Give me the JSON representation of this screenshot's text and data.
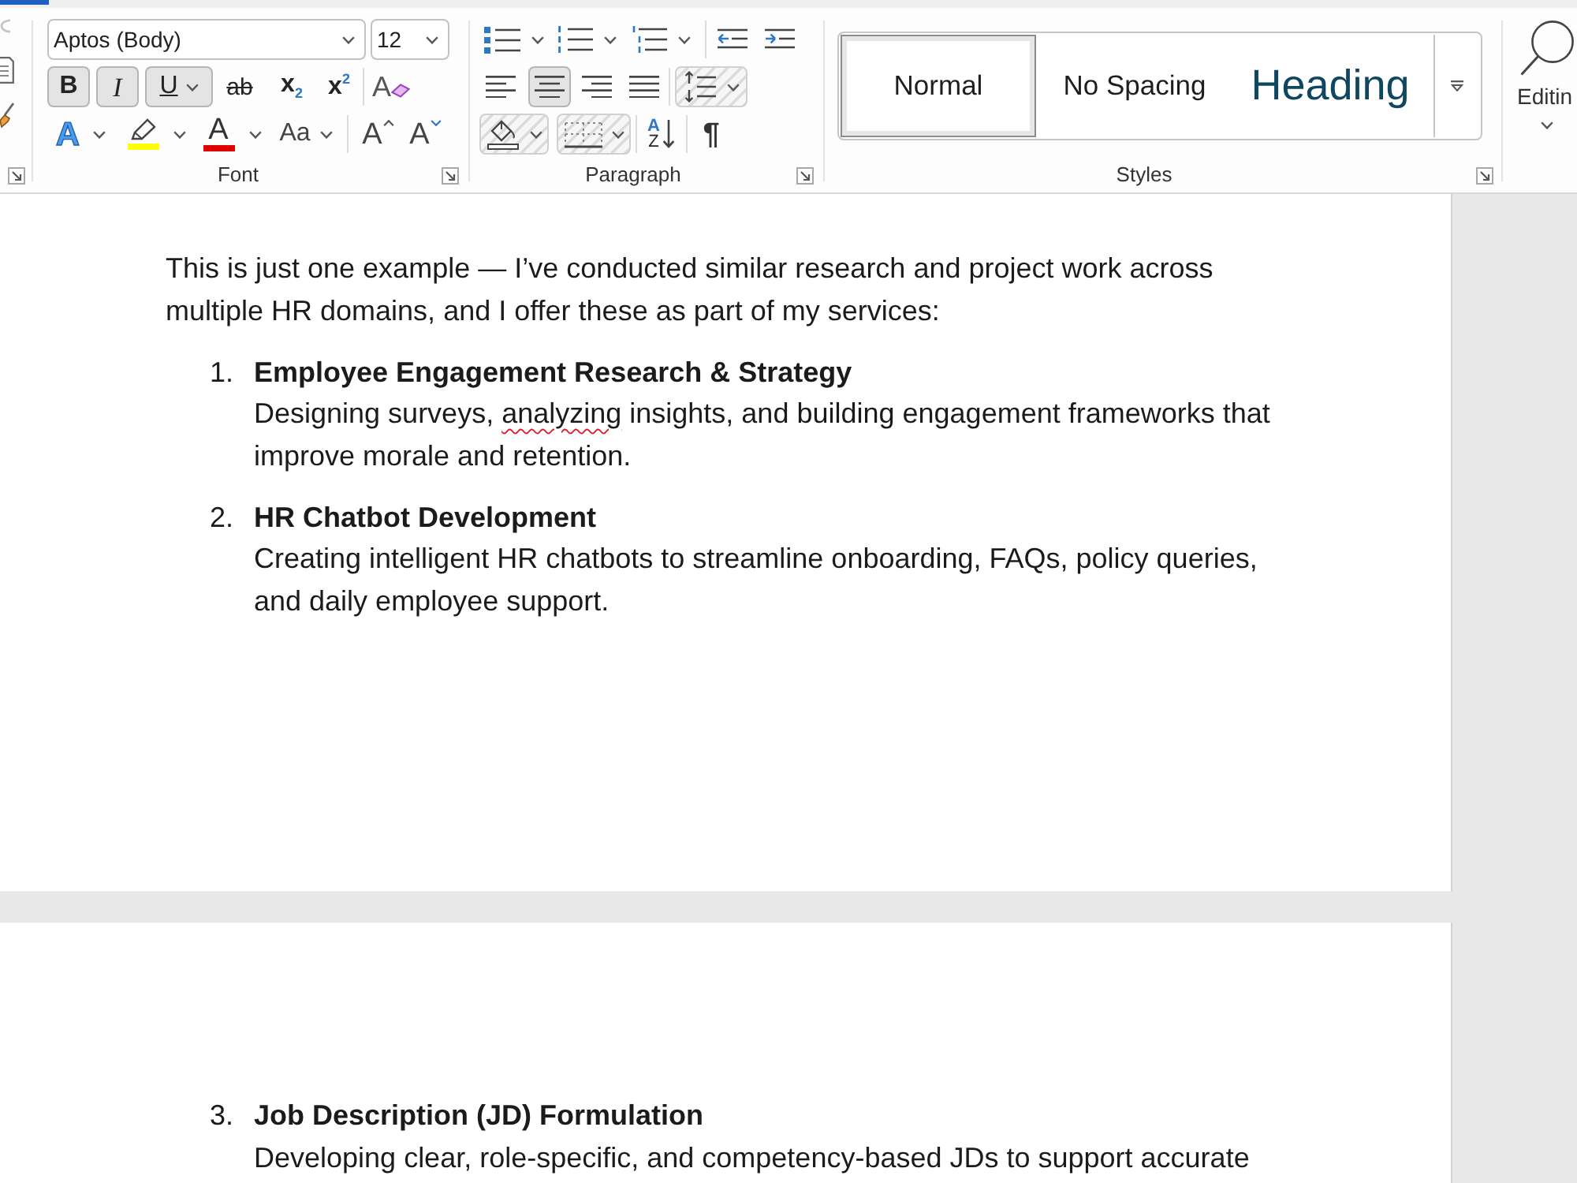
{
  "ribbon": {
    "font_group": {
      "label": "Font",
      "font_name": "Aptos (Body)",
      "font_size": "12",
      "style_buttons": [
        {
          "kind": "bold",
          "text": "B",
          "selected": true
        },
        {
          "kind": "italic",
          "text": "I",
          "selected": true
        },
        {
          "kind": "underline",
          "text": "U",
          "selected": true
        },
        {
          "kind": "strikethrough",
          "text": "ab",
          "selected": false
        },
        {
          "kind": "subscript",
          "text": "x$_{2}$",
          "selected": false
        },
        {
          "kind": "superscript",
          "text": "x$^{2}$",
          "selected": false
        },
        {
          "kind": "clear_formatting",
          "text": "A",
          "selected": false
        }
      ],
      "color_buttons": [
        {
          "kind": "text_effects",
          "text": "A"
        },
        {
          "kind": "highlight",
          "color": "#ffff00"
        },
        {
          "kind": "font_color",
          "text": "A",
          "color": "#e00000"
        },
        {
          "kind": "change_case",
          "text": "Aa"
        },
        {
          "kind": "grow_font",
          "text": "A"
        },
        {
          "kind": "shrink_font",
          "text": "A"
        }
      ]
    },
    "paragraph_group": {
      "label": "Paragraph",
      "list_buttons": [
        {
          "kind": "bullets"
        },
        {
          "kind": "numbering"
        },
        {
          "kind": "multilevel"
        },
        {
          "kind": "decrease_indent"
        },
        {
          "kind": "increase_indent"
        }
      ],
      "align_buttons": [
        {
          "kind": "left",
          "selected": false
        },
        {
          "kind": "center",
          "selected": true
        },
        {
          "kind": "right",
          "selected": false
        },
        {
          "kind": "justify",
          "selected": false
        }
      ],
      "line_spacing": {
        "disabled": true
      },
      "tools": [
        {
          "kind": "shading",
          "disabled": true
        },
        {
          "kind": "borders",
          "disabled": true
        },
        {
          "kind": "sort",
          "texts": [
            "A",
            "Z"
          ],
          "disabled": false
        },
        {
          "kind": "show_marks",
          "text": "¶",
          "disabled": false
        }
      ]
    },
    "styles_group": {
      "label": "Styles",
      "styles": [
        {
          "kind": "normal",
          "name": "Normal",
          "selected": true
        },
        {
          "kind": "no_spacing",
          "name": "No Spacing",
          "selected": false
        },
        {
          "kind": "heading",
          "name": "Heading",
          "selected": false
        }
      ]
    },
    "editing_group": {
      "label": "Editin"
    }
  },
  "document": {
    "pages": [
      {
        "blocks": [
          {
            "kind": "paragraph",
            "text": "This is just one example — I’ve conducted similar research and project work across multiple HR domains, and I offer these as part of my services:"
          },
          {
            "kind": "list_item",
            "number": "1.",
            "title": "Employee Engagement Research & Strategy",
            "description": [
              {
                "text": "Designing surveys, ",
                "misspelled": false
              },
              {
                "text": "analyzing",
                "misspelled": true
              },
              {
                "text": " insights, and building engagement frameworks that improve morale and retention.",
                "misspelled": false
              }
            ]
          },
          {
            "kind": "list_item",
            "number": "2.",
            "title": "HR Chatbot Development",
            "description": [
              {
                "text": "Creating intelligent HR chatbots to streamline onboarding, FAQs, policy queries, and daily employee support.",
                "misspelled": false
              }
            ]
          }
        ]
      },
      {
        "blocks": [
          {
            "kind": "list_item",
            "number": "3.",
            "title": "Job Description (JD) Formulation",
            "description": [
              {
                "text": "Developing clear, role-specific, and competency-based JDs to support accurate",
                "misspelled": false
              }
            ]
          }
        ]
      }
    ]
  }
}
